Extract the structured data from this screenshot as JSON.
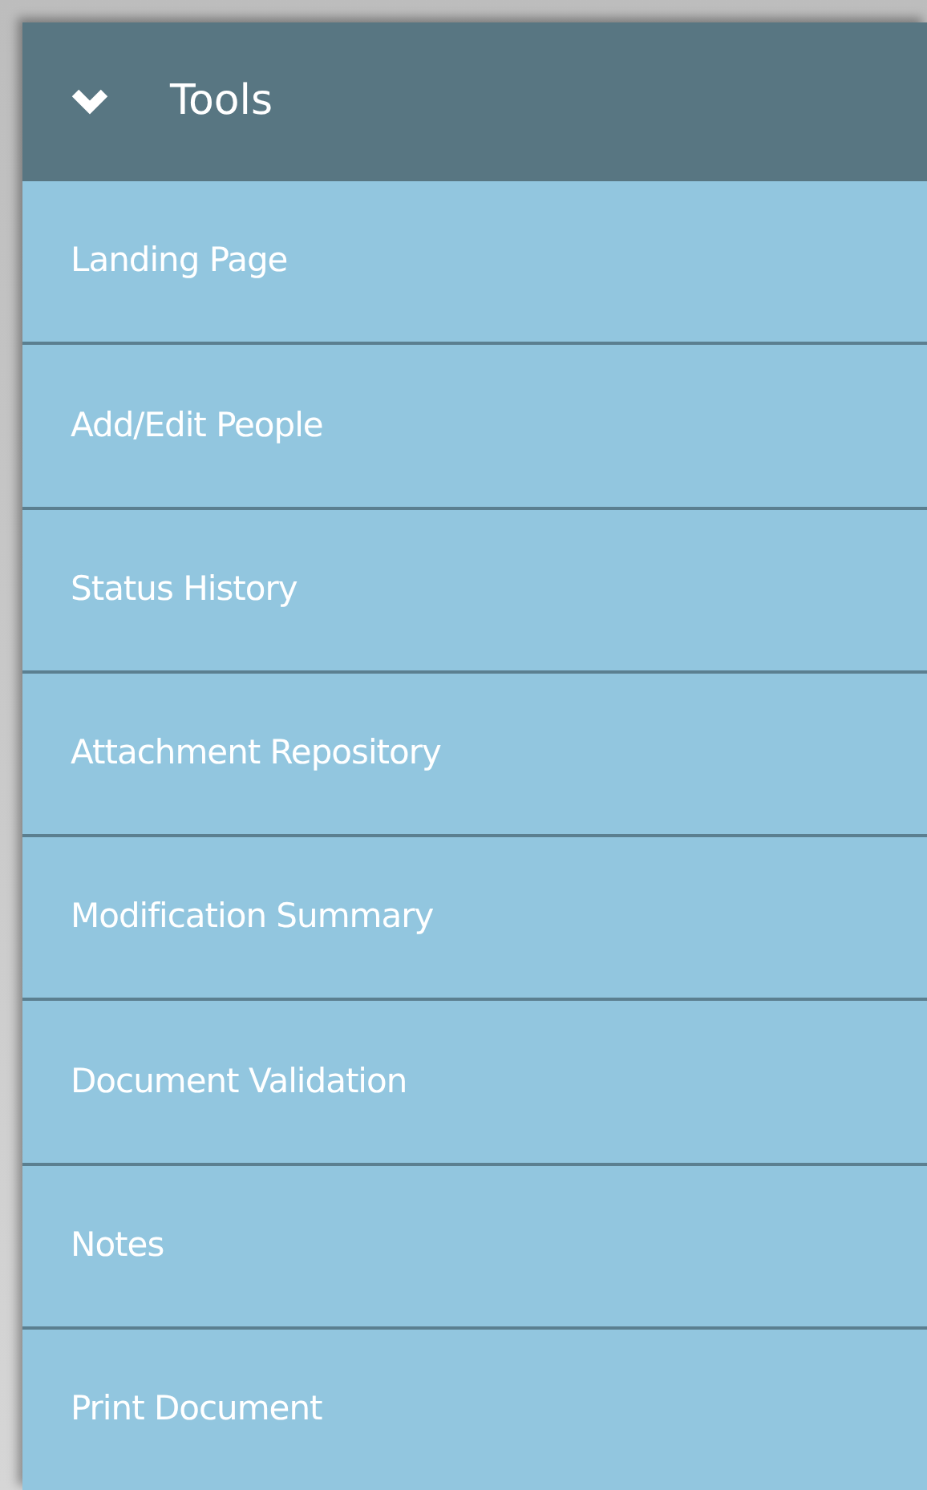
{
  "panel": {
    "title": "Tools",
    "expanded": true
  },
  "items": [
    {
      "label": "Landing Page"
    },
    {
      "label": "Add/Edit People"
    },
    {
      "label": "Status History"
    },
    {
      "label": "Attachment Repository"
    },
    {
      "label": "Modification Summary"
    },
    {
      "label": "Document Validation"
    },
    {
      "label": "Notes"
    },
    {
      "label": "Print Document"
    }
  ]
}
